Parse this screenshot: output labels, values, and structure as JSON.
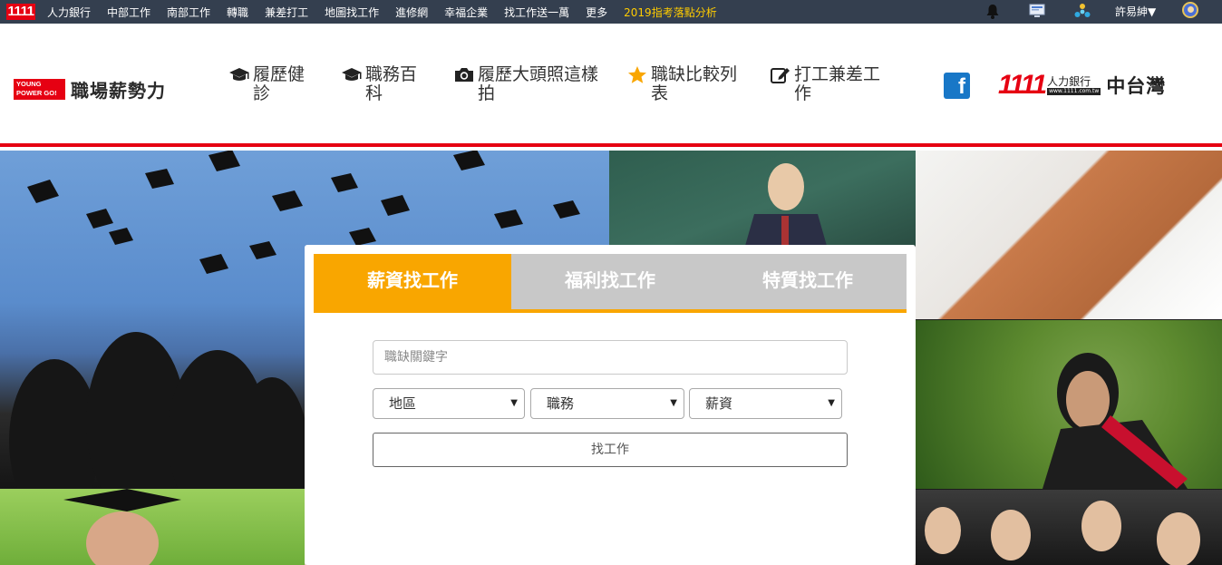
{
  "topbar": {
    "logo_text": "1111",
    "links": [
      "人力銀行",
      "中部工作",
      "南部工作",
      "轉職",
      "兼差打工",
      "地圖找工作",
      "進修網",
      "幸福企業",
      "找工作送一萬",
      "更多"
    ],
    "highlight_link": "2019指考落點分析",
    "highlight_color": "#ffcc00",
    "user_label": "許易紳▼"
  },
  "header": {
    "brand_badge": "YOUNG POWER GO!",
    "brand_name": "職場薪勢力",
    "nav": [
      {
        "icon": "graduation-cap-icon",
        "label": "履歷健診"
      },
      {
        "icon": "graduation-cap-icon",
        "label": "職務百科"
      },
      {
        "icon": "camera-icon",
        "label": "履歷大頭照這樣拍"
      },
      {
        "icon": "star-icon",
        "label": "職缺比較列表"
      },
      {
        "icon": "edit-icon",
        "label": "打工兼差工作"
      }
    ],
    "facebook_letter": "f",
    "partner": {
      "logo_text": "1111",
      "bank_label": "人力銀行",
      "url_text": "www.1111.com.tw",
      "region": "中台灣"
    }
  },
  "search": {
    "tabs": [
      "薪資找工作",
      "福利找工作",
      "特質找工作"
    ],
    "active_tab": 0,
    "active_color": "#f9a600",
    "keyword_placeholder": "職缺關鍵字",
    "selects": [
      "地區",
      "職務",
      "薪資"
    ],
    "submit_label": "找工作"
  },
  "colors": {
    "brand_red": "#e60012",
    "topbar_bg": "#343f4f"
  }
}
